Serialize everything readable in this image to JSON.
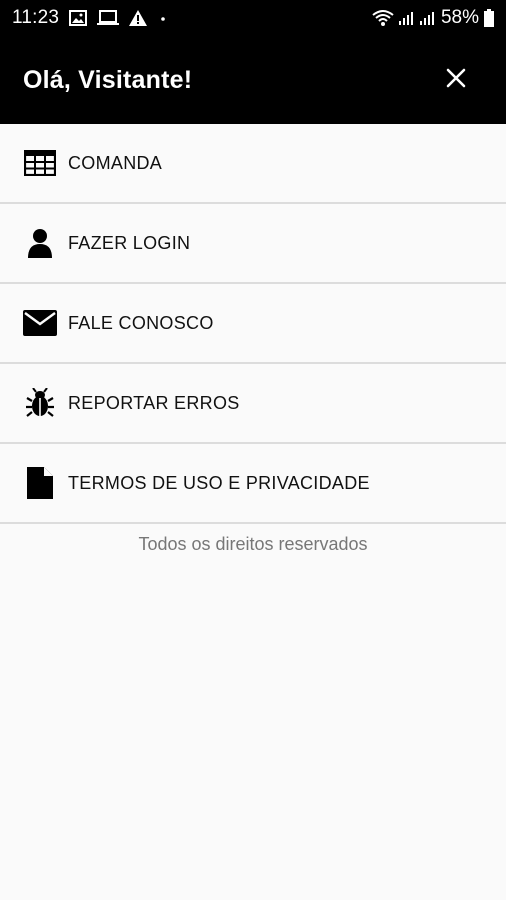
{
  "status_bar": {
    "time": "11:23",
    "battery_percent": "58%",
    "left_icons": [
      "gallery-icon",
      "laptop-icon",
      "alert-icon",
      "dot-icon"
    ],
    "right_icons": [
      "wifi-icon",
      "signal-icon",
      "signal-icon",
      "battery-icon"
    ]
  },
  "header": {
    "title": "Olá, Visitante!",
    "close_icon": "close-icon",
    "background": "#000000"
  },
  "menu": {
    "items": [
      {
        "label": "COMANDA",
        "icon": "grid-table-icon"
      },
      {
        "label": "FAZER LOGIN",
        "icon": "user-icon"
      },
      {
        "label": "FALE CONOSCO",
        "icon": "envelope-icon"
      },
      {
        "label": "REPORTAR ERROS",
        "icon": "bug-icon"
      },
      {
        "label": "TERMOS DE USO E PRIVACIDADE",
        "icon": "document-icon"
      }
    ]
  },
  "footer": {
    "text": "Todos os direitos reservados"
  }
}
